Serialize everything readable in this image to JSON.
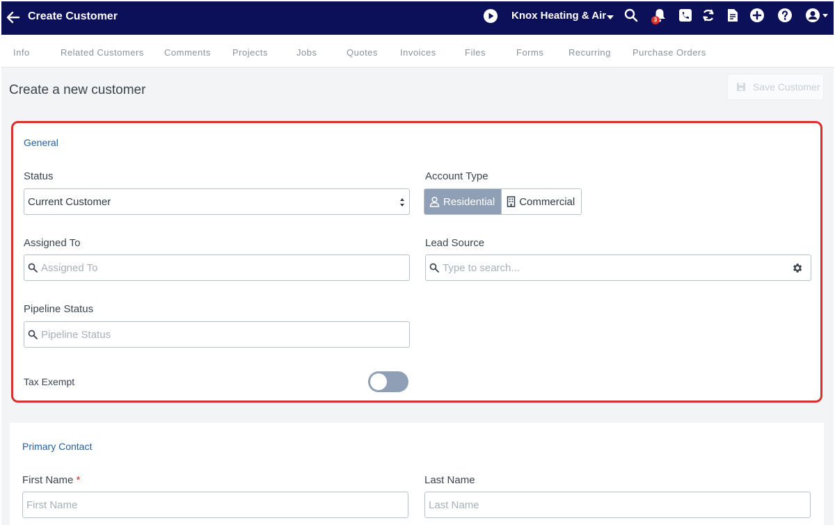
{
  "header": {
    "title": "Create Customer",
    "company": "Knox Heating & Air",
    "notification_count": "3",
    "icons": [
      "back-arrow-icon",
      "play-icon",
      "caret-down-icon",
      "search-icon",
      "bell-icon",
      "phone-icon",
      "sync-icon",
      "document-icon",
      "plus-circle-icon",
      "help-icon",
      "user-account-icon"
    ]
  },
  "tabs": [
    {
      "label": "Info"
    },
    {
      "label": "Related Customers"
    },
    {
      "label": "Comments"
    },
    {
      "label": "Projects"
    },
    {
      "label": "Jobs"
    },
    {
      "label": "Quotes"
    },
    {
      "label": "Invoices"
    },
    {
      "label": "Files"
    },
    {
      "label": "Forms"
    },
    {
      "label": "Recurring"
    },
    {
      "label": "Purchase Orders"
    }
  ],
  "page": {
    "heading": "Create a new customer",
    "save_label": "Save Customer"
  },
  "general": {
    "heading": "General",
    "status": {
      "label": "Status",
      "value": "Current Customer"
    },
    "account_type": {
      "label": "Account Type",
      "options": [
        "Residential",
        "Commercial"
      ],
      "selected": "Residential"
    },
    "assigned_to": {
      "label": "Assigned To",
      "placeholder": "Assigned To"
    },
    "lead_source": {
      "label": "Lead Source",
      "placeholder": "Type to search..."
    },
    "pipeline_status": {
      "label": "Pipeline Status",
      "placeholder": "Pipeline Status"
    },
    "tax_exempt": {
      "label": "Tax Exempt",
      "enabled": false
    }
  },
  "primary_contact": {
    "heading": "Primary Contact",
    "first_name": {
      "label": "First Name",
      "required_mark": "*",
      "placeholder": "First Name"
    },
    "last_name": {
      "label": "Last Name",
      "placeholder": "Last Name"
    }
  },
  "colors": {
    "topbar": "#0c1058",
    "accent_blue": "#245c9c",
    "highlight_border": "#d9302c",
    "toggle_and_active_segment": "#8f9fb6"
  }
}
